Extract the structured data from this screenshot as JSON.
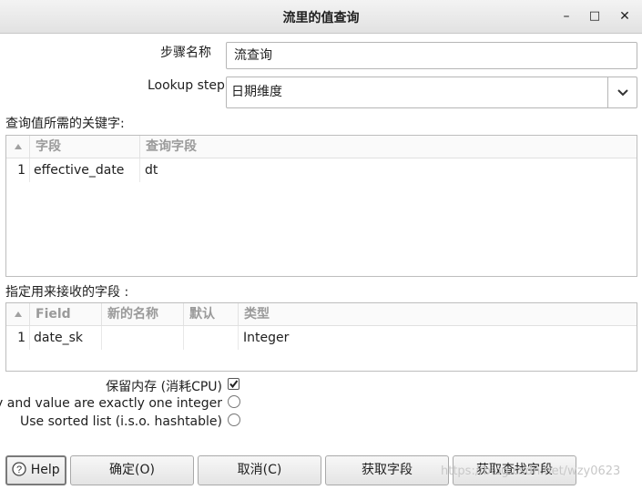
{
  "window": {
    "title": "流里的值查询",
    "minimize_glyph": "–",
    "maximize_glyph": "□",
    "close_glyph": "✕"
  },
  "step_name": {
    "label": "步骤名称",
    "value": "流查询"
  },
  "lookup_step": {
    "label": "Lookup step",
    "value": "日期维度"
  },
  "keys_section": {
    "label": "查询值所需的关键字:",
    "columns": [
      "字段",
      "查询字段"
    ],
    "rows": [
      {
        "num": "1",
        "field": "effective_date",
        "lookup_field": "dt"
      }
    ]
  },
  "fields_section": {
    "label": "指定用来接收的字段 :",
    "columns": [
      "Field",
      "新的名称",
      "默认",
      "类型"
    ],
    "rows": [
      {
        "num": "1",
        "field": "date_sk",
        "new_name": "",
        "default": "",
        "type": "Integer"
      }
    ]
  },
  "options": {
    "preserve_memory": {
      "label": "保留内存 (消耗CPU)",
      "checked": true
    },
    "one_integer": {
      "label": "Key and value are exactly one integer",
      "checked": false
    },
    "sorted_list": {
      "label": "Use sorted list (i.s.o. hashtable)",
      "checked": false
    }
  },
  "buttons": {
    "help": "Help",
    "ok": "确定(O)",
    "cancel": "取消(C)",
    "get_fields": "获取字段",
    "get_lookup_fields": "获取查找字段"
  },
  "watermark": "https://blog.csdn.net/wzy0623"
}
